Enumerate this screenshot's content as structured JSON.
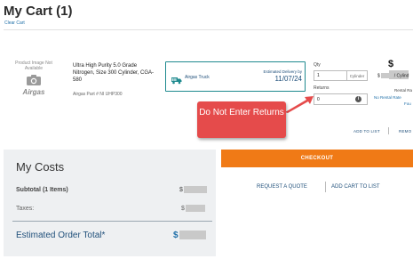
{
  "header": {
    "title": "My Cart (1)",
    "clear_cart": "Clear Cart"
  },
  "product": {
    "image_placeholder": "Product Image Not Available",
    "brand": "Airgas",
    "name": "Ultra High Purity 5.0 Grade Nitrogen, Size 300 Cylinder, CGA-580",
    "part_number": "Airgas Part # NI UHP300"
  },
  "delivery": {
    "method": "Airgas Truck",
    "estimated_label": "Estimated Delivery by",
    "estimated_date": "11/07/24"
  },
  "quantity": {
    "qty_label": "Qty",
    "qty_value": "1",
    "unit": "Cylinder",
    "returns_label": "Returns",
    "returns_value": "0",
    "info_icon": "i"
  },
  "pricing": {
    "currency": "$",
    "per_unit_suffix": "/ Cylind",
    "rental_line_1": "Rental Ra",
    "rental_line_2": "No Rental Rate",
    "rental_line_3": "Fou"
  },
  "item_actions": {
    "add_to_list": "ADD TO LIST",
    "remove": "REMO"
  },
  "callout": {
    "text": "Do Not Enter Returns",
    "color": "#e54b4b"
  },
  "checkout": {
    "checkout_label": "CHECKOUT",
    "request_quote": "REQUEST A QUOTE",
    "add_cart_to_list": "ADD CART TO LIST",
    "accent": "#f07a16"
  },
  "costs": {
    "title": "My Costs",
    "subtotal_label": "Subtotal  (1 Items)",
    "subtotal_prefix": "$",
    "taxes_label": "Taxes:",
    "taxes_prefix": "$",
    "estimated_total_label": "Estimated Order Total*",
    "estimated_total_prefix": "$"
  },
  "icons": {
    "camera": "camera-icon",
    "truck": "truck-icon",
    "info": "info-icon",
    "arrow": "callout-arrow-icon"
  }
}
